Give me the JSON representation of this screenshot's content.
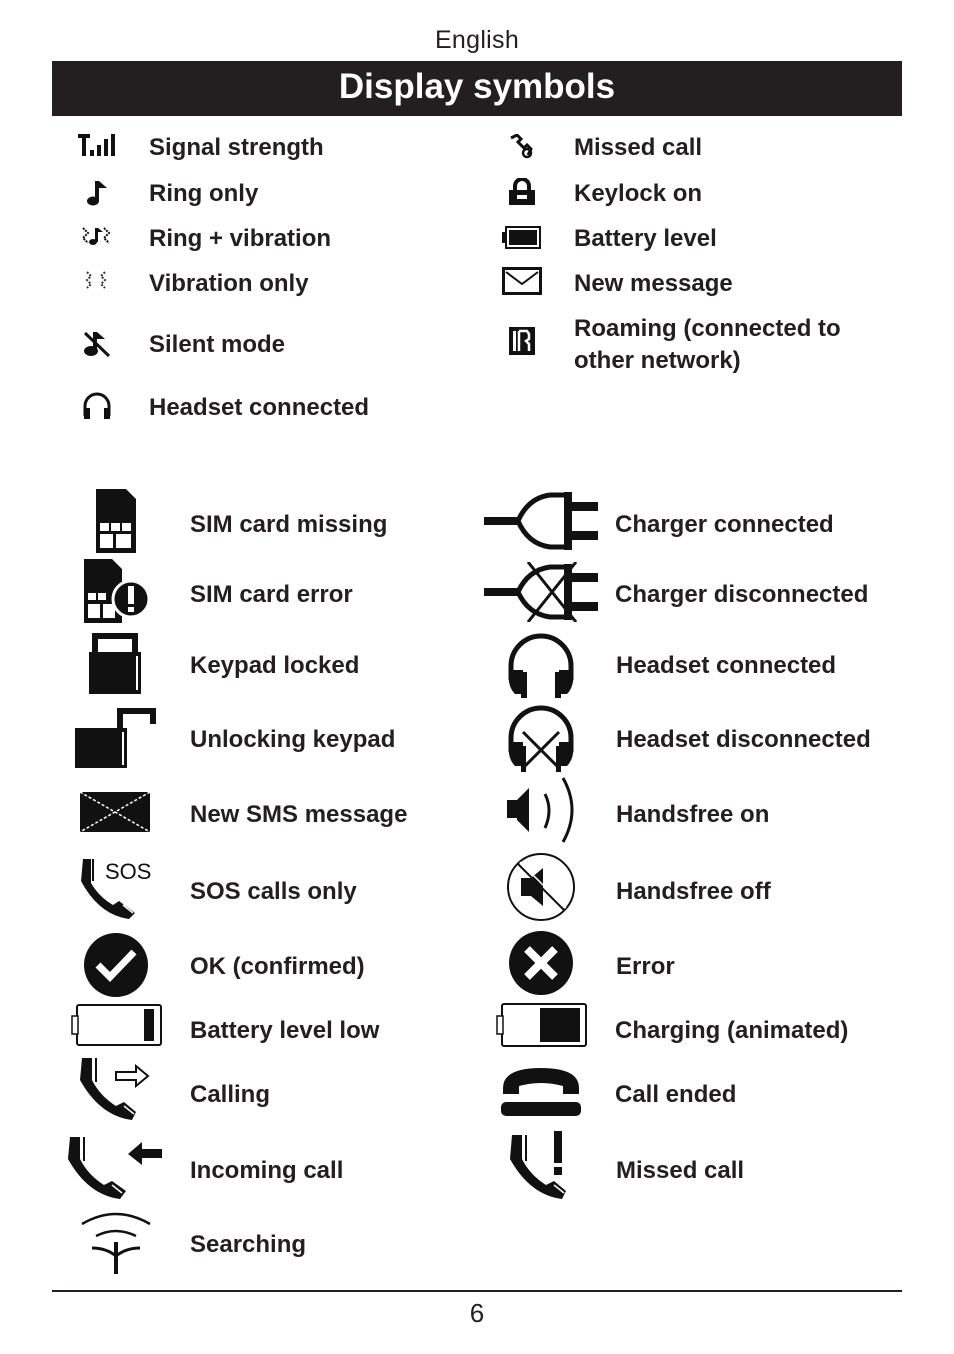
{
  "header": {
    "language": "English",
    "title": "Display symbols"
  },
  "small_symbols": {
    "left": [
      {
        "icon": "signal-strength-icon",
        "label": "Signal strength"
      },
      {
        "icon": "ring-only-icon",
        "label": "Ring only"
      },
      {
        "icon": "ring-vibration-icon",
        "label": "Ring + vibration"
      },
      {
        "icon": "vibration-only-icon",
        "label": "Vibration only"
      },
      {
        "icon": "silent-mode-icon",
        "label": "Silent mode"
      },
      {
        "icon": "headset-icon",
        "label": "Headset connected"
      }
    ],
    "right": [
      {
        "icon": "missed-call-small-icon",
        "label": "Missed call"
      },
      {
        "icon": "keylock-icon",
        "label": "Keylock on"
      },
      {
        "icon": "battery-level-icon",
        "label": "Battery level"
      },
      {
        "icon": "envelope-icon",
        "label": "New message"
      },
      {
        "icon": "roaming-icon",
        "label": "Roaming (connected to other network)"
      }
    ]
  },
  "large_symbols": {
    "left": [
      {
        "icon": "sim-card-missing-icon",
        "label": "SIM card missing"
      },
      {
        "icon": "sim-card-error-icon",
        "label": "SIM card error"
      },
      {
        "icon": "padlock-closed-icon",
        "label": "Keypad locked"
      },
      {
        "icon": "padlock-open-icon",
        "label": "Unlocking keypad"
      },
      {
        "icon": "sms-envelope-icon",
        "label": "New SMS message"
      },
      {
        "icon": "sos-phone-icon",
        "label": "SOS calls only",
        "icon_text": "SOS"
      },
      {
        "icon": "check-circle-icon",
        "label": "OK (confirmed)"
      },
      {
        "icon": "battery-low-icon",
        "label": "Battery level low"
      },
      {
        "icon": "phone-outgoing-icon",
        "label": "Calling"
      },
      {
        "icon": "phone-incoming-icon",
        "label": "Incoming call"
      },
      {
        "icon": "antenna-searching-icon",
        "label": "Searching"
      }
    ],
    "right": [
      {
        "icon": "plug-connected-icon",
        "label": "Charger connected"
      },
      {
        "icon": "plug-disconnected-icon",
        "label": "Charger disconnected"
      },
      {
        "icon": "headphones-icon",
        "label": "Headset connected"
      },
      {
        "icon": "headphones-crossed-icon",
        "label": "Headset disconnected"
      },
      {
        "icon": "speaker-on-icon",
        "label": "Handsfree on"
      },
      {
        "icon": "speaker-off-icon",
        "label": "Handsfree off"
      },
      {
        "icon": "error-circle-icon",
        "label": "Error"
      },
      {
        "icon": "battery-charging-icon",
        "label": "Charging (animated)"
      },
      {
        "icon": "phone-hangup-icon",
        "label": "Call ended"
      },
      {
        "icon": "phone-missed-icon",
        "label": "Missed call"
      }
    ]
  },
  "footer": {
    "page_number": "6"
  }
}
